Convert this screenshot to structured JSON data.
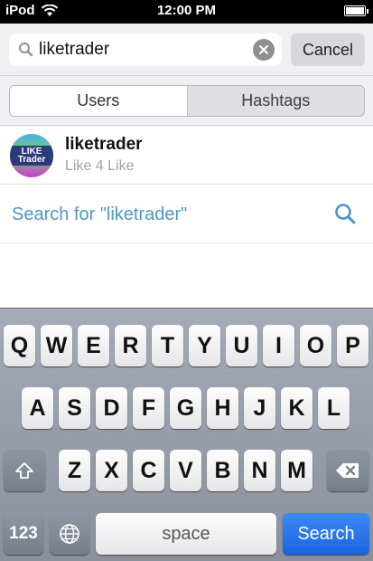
{
  "status_bar": {
    "carrier": "iPod",
    "time": "12:00 PM"
  },
  "search": {
    "query": "liketrader",
    "cancel_label": "Cancel"
  },
  "segments": [
    {
      "label": "Users",
      "active": true
    },
    {
      "label": "Hashtags",
      "active": false
    }
  ],
  "results": {
    "user": {
      "username": "liketrader",
      "subtitle": "Like 4 Like",
      "avatar_text": "LIKE Trader"
    },
    "search_for": "Search for \"liketrader\""
  },
  "keyboard": {
    "row1": [
      "Q",
      "W",
      "E",
      "R",
      "T",
      "Y",
      "U",
      "I",
      "O",
      "P"
    ],
    "row2": [
      "A",
      "S",
      "D",
      "F",
      "G",
      "H",
      "J",
      "K",
      "L"
    ],
    "row3": [
      "Z",
      "X",
      "C",
      "V",
      "B",
      "N",
      "M"
    ],
    "numbers_label": "123",
    "space_label": "space",
    "search_label": "Search"
  },
  "colors": {
    "accent": "#4b97c4",
    "search_key": "#1a63e0",
    "keyboard_bg": "#9ba1ad"
  }
}
